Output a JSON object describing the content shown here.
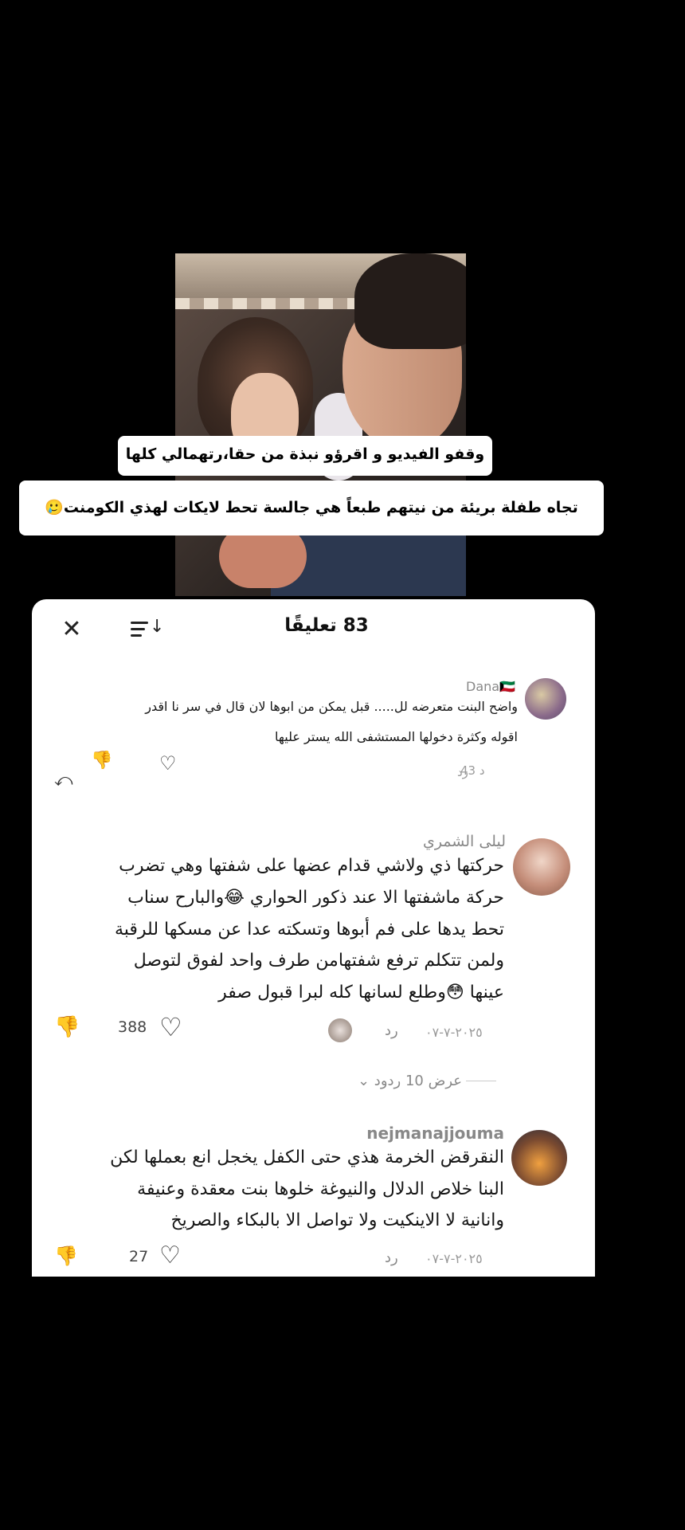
{
  "captions": {
    "line1": "وقفو الفيديو و اقرؤو نبذة من حقا،رتهمالي كلها",
    "line2": "تجاه طفلة بريئة من نيتهم طبعاً هي جالسة تحط لايكات لهذي الكومنت🥲"
  },
  "panel": {
    "title": "83 تعليقًا",
    "close_icon": "close-icon",
    "sort_icon": "sort-icon"
  },
  "comments": [
    {
      "author": "Dana🇰🇼",
      "text_line1": "واضح البنت متعرضه لل..... قبل يمكن من ابوها لان قال في سر نا اقدر",
      "text_line2": "اقوله وكثرة دخولها المستشفى الله يستر عليها",
      "time": "43 د",
      "reply": "رد"
    },
    {
      "author": "ليلى الشمري",
      "lines": [
        "حركتها ذي ولاشي قدام عضها على شفتها وهي تضرب",
        "حركة ماشفتها الا عند ذكور الحواري 😂والبارح سناب",
        "تحط يدها على فم أبوها وتسكته عدا عن مسكها للرقبة",
        "ولمن تتكلم ترفع شفتهامن طرف واحد لفوق لتوصل",
        "عينها 😳وطلع لسانها كله لبرا قبول صفر"
      ],
      "date": "٢٠٢٥-٧-٠٧",
      "reply": "رد",
      "likes": "388"
    },
    {
      "author": "nejmanajjouma",
      "lines": [
        "النقرقض الخرمة هذي حتى الكفل يخجل انع بعملها لكن",
        "البنا خلاص الدلال والنيوغة خلوها بنت معقدة وعنيفة",
        "وانانية لا الاينكيت ولا تواصل الا بالبكاء والصريخ"
      ],
      "date": "٢٠٢٥-٧-٠٧",
      "reply": "رد",
      "likes": "27"
    }
  ],
  "view_replies": "عرض 10 ردود",
  "colors": {
    "panel_bg": "#ffffff",
    "muted": "#888888",
    "text": "#161616"
  }
}
